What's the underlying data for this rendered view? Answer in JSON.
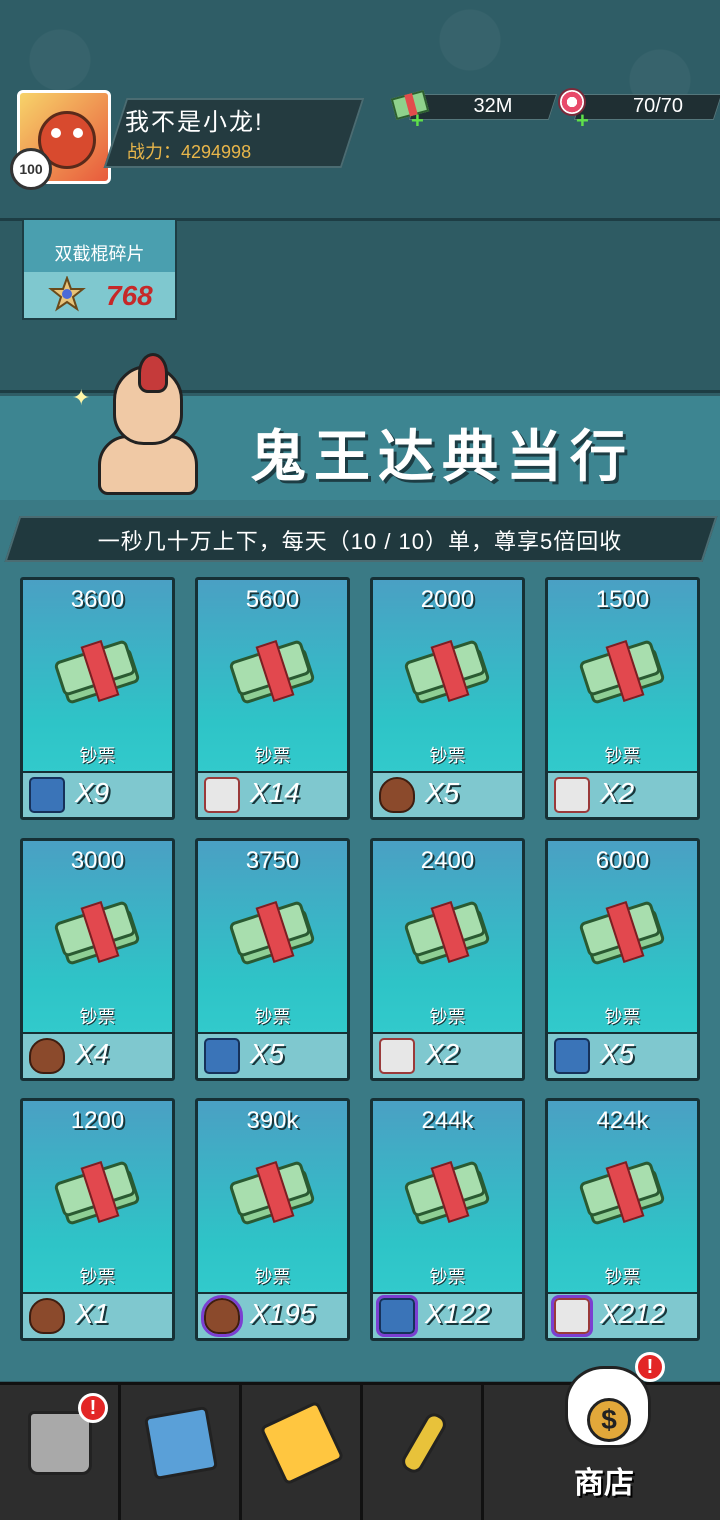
{
  "player": {
    "name": "我不是小龙!",
    "power_label": "战力：4294998",
    "level": "100"
  },
  "resources": {
    "cash": "32M",
    "energy": "70/70"
  },
  "fragment": {
    "name": "双截棍碎片",
    "count": "768"
  },
  "shop": {
    "title": "鬼王达典当行",
    "subtitle": "一秒几十万上下，每天（10 / 10）单，尊享5倍回收"
  },
  "cards": [
    {
      "price": "3600",
      "item": "钞票",
      "req_icon": "jacket-icon",
      "req": "X9"
    },
    {
      "price": "5600",
      "item": "钞票",
      "req_icon": "shoe-icon",
      "req": "X14"
    },
    {
      "price": "2000",
      "item": "钞票",
      "req_icon": "meat-icon",
      "req": "X5"
    },
    {
      "price": "1500",
      "item": "钞票",
      "req_icon": "shoe-icon",
      "req": "X2"
    },
    {
      "price": "3000",
      "item": "钞票",
      "req_icon": "meat-icon",
      "req": "X4"
    },
    {
      "price": "3750",
      "item": "钞票",
      "req_icon": "jacket-icon",
      "req": "X5"
    },
    {
      "price": "2400",
      "item": "钞票",
      "req_icon": "shoe-icon",
      "req": "X2"
    },
    {
      "price": "6000",
      "item": "钞票",
      "req_icon": "jacket-icon",
      "req": "X5"
    },
    {
      "price": "1200",
      "item": "钞票",
      "req_icon": "meat-icon",
      "req": "X1"
    },
    {
      "price": "390k",
      "item": "钞票",
      "req_icon": "meat-icon",
      "req": "X195"
    },
    {
      "price": "244k",
      "item": "钞票",
      "req_icon": "jacket-icon",
      "req": "X122"
    },
    {
      "price": "424k",
      "item": "钞票",
      "req_icon": "shoe-icon",
      "req": "X212"
    }
  ],
  "nav": {
    "shop_label": "商店",
    "alert_symbol": "!"
  }
}
